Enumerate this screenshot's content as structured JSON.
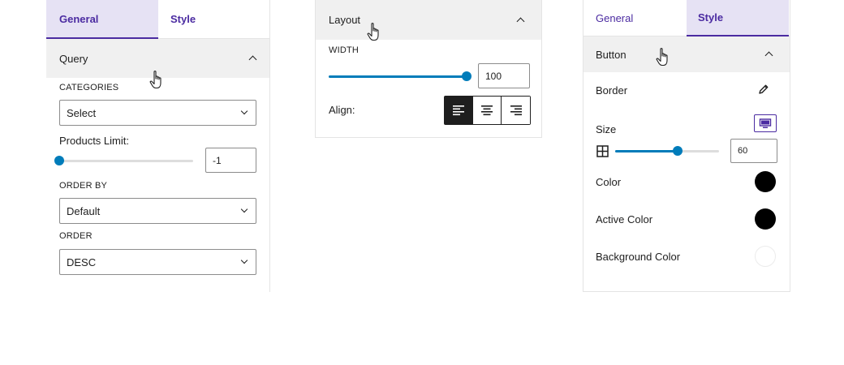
{
  "panel_query": {
    "tabs": [
      {
        "label": "General",
        "active": true
      },
      {
        "label": "Style",
        "active": false
      }
    ],
    "section_title": "Query",
    "categories_label": "CATEGORIES",
    "categories_value": "Select",
    "products_limit_label": "Products Limit:",
    "products_limit_value": "-1",
    "products_limit_slider_fraction": 0.0,
    "order_by_label": "ORDER BY",
    "order_by_value": "Default",
    "order_label": "ORDER",
    "order_value": "DESC"
  },
  "panel_layout": {
    "section_title": "Layout",
    "width_label": "WIDTH",
    "width_value": "100",
    "width_slider_fraction": 1.0,
    "align_label": "Align:",
    "align_options": [
      "left",
      "center",
      "right"
    ],
    "align_selected": "left"
  },
  "panel_style": {
    "tabs": [
      {
        "label": "General",
        "active": false
      },
      {
        "label": "Style",
        "active": true
      }
    ],
    "section_title": "Button",
    "border_label": "Border",
    "size_label": "Size",
    "size_value": "60",
    "size_slider_fraction": 0.6,
    "color_label": "Color",
    "color_value": "#000000",
    "active_color_label": "Active Color",
    "active_color_value": "#000000",
    "background_color_label": "Background Color",
    "background_color_value": "#ffffff"
  },
  "colors": {
    "accent": "#4b2ba1",
    "accent_bg": "#e6e2f4",
    "slider": "#007cba",
    "section_bg": "#f0f0f0"
  },
  "icons": [
    "chevron-up-icon",
    "chevron-down-icon",
    "pencil-icon",
    "desktop-icon",
    "grid-icon",
    "align-left-icon",
    "align-center-icon",
    "align-right-icon",
    "hand-pointer-icon"
  ]
}
